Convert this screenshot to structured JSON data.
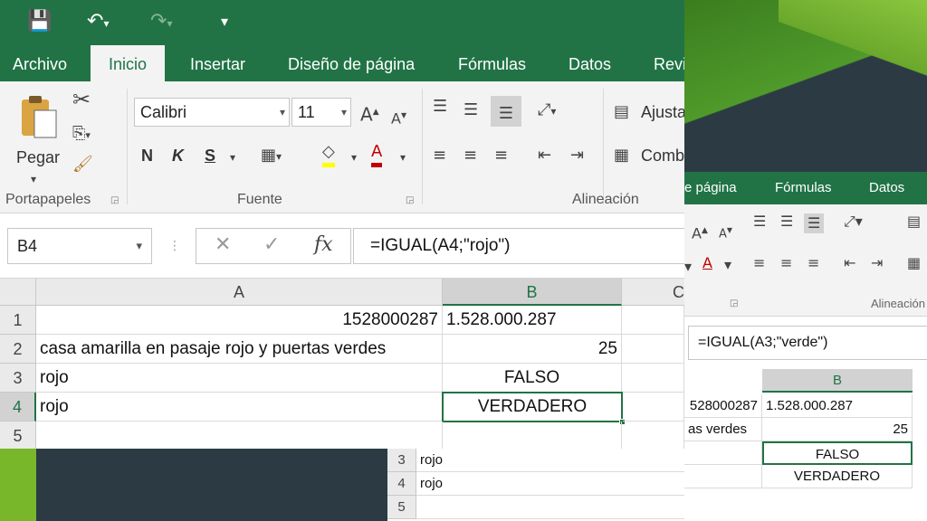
{
  "colors": {
    "excel_green": "#217346",
    "background_dark": "#2c3b43",
    "accent_lime": "#78b62a"
  },
  "qat": {
    "icons": [
      "save-icon",
      "undo-icon",
      "redo-icon",
      "customize-icon"
    ]
  },
  "tabs": [
    {
      "label": "Archivo"
    },
    {
      "label": "Inicio"
    },
    {
      "label": "Insertar"
    },
    {
      "label": "Diseño de página"
    },
    {
      "label": "Fórmulas"
    },
    {
      "label": "Datos"
    },
    {
      "label": "Revi"
    }
  ],
  "ribbon": {
    "clipboard": {
      "paste_label": "Pegar",
      "group_label": "Portapapeles"
    },
    "font": {
      "name": "Calibri",
      "size": "11",
      "bold": "N",
      "italic": "K",
      "underline": "S",
      "group_label": "Fuente"
    },
    "alignment": {
      "wrap_label": "Ajusta",
      "merge_label": "Comb",
      "group_label": "Alineación"
    }
  },
  "formula_bar": {
    "name_box": "B4",
    "formula": "=IGUAL(A4;\"rojo\")"
  },
  "sheet": {
    "columns": [
      "A",
      "B",
      "C"
    ],
    "rows": [
      {
        "num": "1",
        "a": "1528000287",
        "b": "1.528.000.287"
      },
      {
        "num": "2",
        "a": "casa amarilla en pasaje rojo y puertas verdes",
        "b": "25"
      },
      {
        "num": "3",
        "a": "rojo",
        "b": "FALSO"
      },
      {
        "num": "4",
        "a": "rojo",
        "b": "VERDADERO"
      },
      {
        "num": "5",
        "a": "",
        "b": ""
      }
    ]
  },
  "right_window": {
    "tabs": [
      {
        "label": "e página"
      },
      {
        "label": "Fórmulas"
      },
      {
        "label": "Datos"
      }
    ],
    "group_label": "Alineación",
    "formula": "=IGUAL(A3;\"verde\")",
    "column": "B",
    "rows": [
      {
        "a": "528000287",
        "b": "1.528.000.287"
      },
      {
        "a": "as verdes",
        "b": "25"
      },
      {
        "a": "",
        "b": "FALSO"
      },
      {
        "a": "",
        "b": "VERDADERO"
      }
    ]
  },
  "mid_window": {
    "rows": [
      {
        "num": "3",
        "a": "rojo"
      },
      {
        "num": "4",
        "a": "rojo"
      },
      {
        "num": "5",
        "a": ""
      }
    ]
  }
}
